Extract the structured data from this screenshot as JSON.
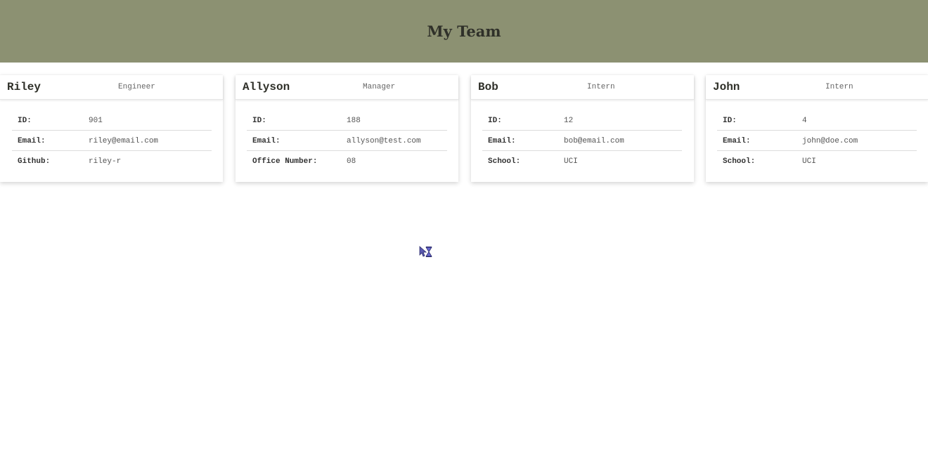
{
  "header": {
    "title": "My Team"
  },
  "cards": [
    {
      "name": "Riley",
      "role": "Engineer",
      "rows": [
        {
          "label": "ID:",
          "value": "901"
        },
        {
          "label": "Email:",
          "value": "riley@email.com"
        },
        {
          "label": "Github:",
          "value": "riley-r"
        }
      ]
    },
    {
      "name": "Allyson",
      "role": "Manager",
      "rows": [
        {
          "label": "ID:",
          "value": "188"
        },
        {
          "label": "Email:",
          "value": "allyson@test.com"
        },
        {
          "label": "Office Number:",
          "value": "08"
        }
      ]
    },
    {
      "name": "Bob",
      "role": "Intern",
      "rows": [
        {
          "label": "ID:",
          "value": "12"
        },
        {
          "label": "Email:",
          "value": "bob@email.com"
        },
        {
          "label": "School:",
          "value": "UCI"
        }
      ]
    },
    {
      "name": "John",
      "role": "Intern",
      "rows": [
        {
          "label": "ID:",
          "value": "4"
        },
        {
          "label": "Email:",
          "value": "john@doe.com"
        },
        {
          "label": "School:",
          "value": "UCI"
        }
      ]
    }
  ],
  "colors": {
    "header_bg": "#8c9172",
    "title_text": "#2f3029"
  },
  "cursor": {
    "icon": "busy-arrow-cursor-icon"
  }
}
